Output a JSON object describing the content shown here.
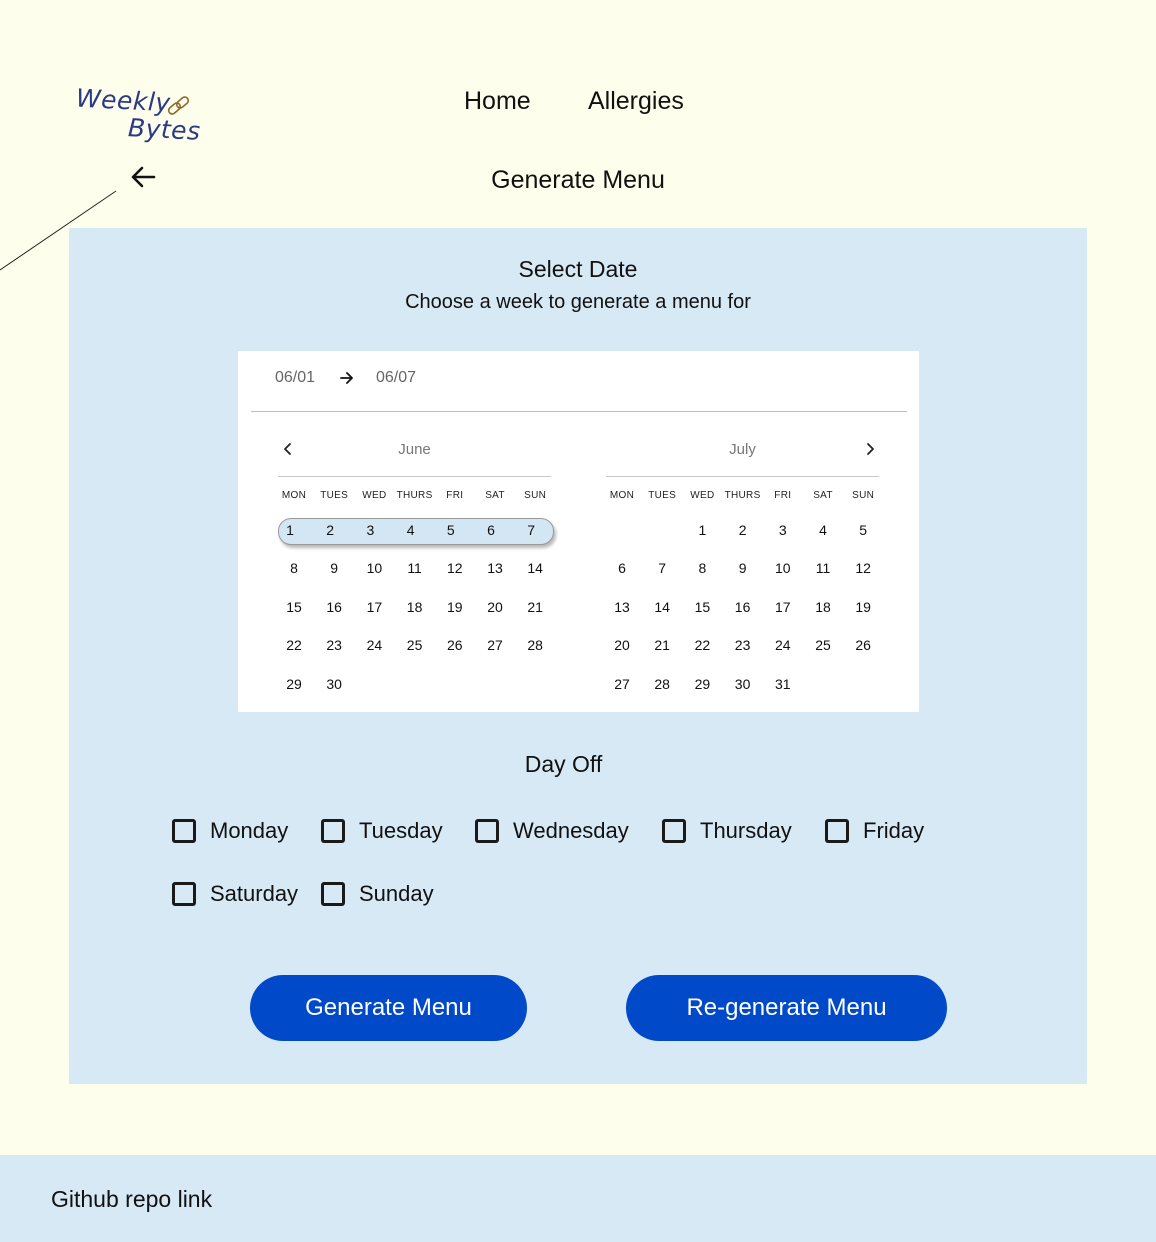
{
  "logo": {
    "line1": "Weekly",
    "line2": "Bytes"
  },
  "nav": {
    "home": "Home",
    "allergies": "Allergies"
  },
  "page_title": "Generate Menu",
  "select_date": {
    "title": "Select Date",
    "subtitle": "Choose a week to generate a menu for"
  },
  "calendar": {
    "range_start": "06/01",
    "range_end": "06/07",
    "weekdays": [
      "MON",
      "TUES",
      "WED",
      "THURS",
      "FRI",
      "SAT",
      "SUN"
    ],
    "months": [
      {
        "name": "June",
        "first_weekday_index": 0,
        "days": 30,
        "selected_week": [
          1,
          7
        ]
      },
      {
        "name": "July",
        "first_weekday_index": 2,
        "days": 31,
        "selected_week": null
      }
    ]
  },
  "day_off": {
    "title": "Day Off",
    "options": [
      {
        "label": "Monday",
        "checked": false
      },
      {
        "label": "Tuesday",
        "checked": false
      },
      {
        "label": "Wednesday",
        "checked": false
      },
      {
        "label": "Thursday",
        "checked": false
      },
      {
        "label": "Friday",
        "checked": false
      },
      {
        "label": "Saturday",
        "checked": false
      },
      {
        "label": "Sunday",
        "checked": false
      }
    ]
  },
  "buttons": {
    "generate": "Generate Menu",
    "regenerate": "Re-generate Menu"
  },
  "footer": {
    "github_link": "Github repo link"
  },
  "colors": {
    "page_bg": "#fefeec",
    "panel_bg": "#d8e9f6",
    "button_bg": "#0049c9",
    "logo": "#2b3a85"
  }
}
